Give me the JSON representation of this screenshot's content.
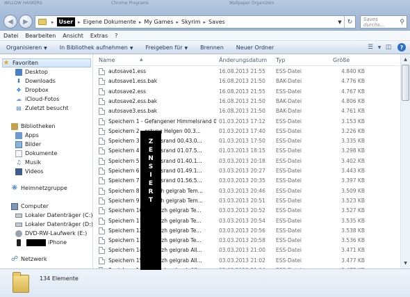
{
  "window": {
    "ghost_title_fragments": [
      "WILLOW HASKERS",
      "Chrome Programs",
      "Wallpaper Organizers"
    ]
  },
  "address": {
    "crumbs": [
      "User",
      "Eigene Dokumente",
      "My Games",
      "Skyrim",
      "Saves"
    ],
    "search_placeholder": "Saves durchs..."
  },
  "menu": [
    "Datei",
    "Bearbeiten",
    "Ansicht",
    "Extras",
    "?"
  ],
  "toolbar": {
    "organize": "Organisieren",
    "include_library": "In Bibliothek aufnehmen",
    "share": "Freigeben für",
    "burn": "Brennen",
    "new_folder": "Neuer Ordner",
    "help": "?"
  },
  "nav": {
    "favorites": "Favoriten",
    "desktop": "Desktop",
    "downloads": "Downloads",
    "dropbox": "Dropbox",
    "icloud": "iCloud-Fotos",
    "recent": "Zuletzt besucht",
    "libraries": "Bibliotheken",
    "apps": "Apps",
    "pictures": "Bilder",
    "documents": "Dokumente",
    "music": "Musik",
    "videos": "Videos",
    "homegroup": "Heimnetzgruppe",
    "computer": "Computer",
    "drive_c": "Lokaler Datenträger (C:)",
    "drive_d": "Lokaler Datenträger (D:)",
    "drive_e": "DVD-RW-Laufwerk (E:)",
    "iphone": "iPhone",
    "network": "Netzwerk"
  },
  "columns": {
    "name": "Name",
    "date": "Änderungsdatum",
    "type": "Typ",
    "size": "Größe"
  },
  "files": [
    {
      "name": "autosave1.ess",
      "date": "16.08.2013 21:55",
      "type": "ESS-Datei",
      "size": "4.840 KB"
    },
    {
      "name": "autosave1.ess.bak",
      "date": "16.08.2013 21:50",
      "type": "BAK-Datei",
      "size": "4.776 KB"
    },
    {
      "name": "autosave2.ess",
      "date": "16.08.2013 21:55",
      "type": "ESS-Datei",
      "size": "4.767 KB"
    },
    {
      "name": "autosave2.ess.bak",
      "date": "16.08.2013 21:50",
      "type": "BAK-Datei",
      "size": "4.806 KB"
    },
    {
      "name": "autosave3.ess.bak",
      "date": "16.08.2013 21:50",
      "type": "BAK-Datei",
      "size": "4.761 KB"
    },
    {
      "name": "Speichern 1 - Gefangener  Himmelsrand  0...",
      "date": "01.03.2013 17:12",
      "type": "ESS-Datei",
      "size": "3.153 KB"
    },
    {
      "name": "Speichern 2 -          estung Helgen  00.3...",
      "date": "01.03.2013 17:40",
      "type": "ESS-Datei",
      "size": "3.226 KB"
    },
    {
      "name": "Speichern 3 -          immelsrand  00.43.0...",
      "date": "01.03.2013 17:50",
      "type": "ESS-Datei",
      "size": "3.335 KB"
    },
    {
      "name": "Speichern 4 -          immelsrand  01.07.5...",
      "date": "01.03.2013 18:15",
      "type": "ESS-Datei",
      "size": "3.298 KB"
    },
    {
      "name": "Speichern 5 -          immelsrand  01.40.1...",
      "date": "03.03.2013 20:18",
      "type": "ESS-Datei",
      "size": "3.402 KB"
    },
    {
      "name": "Speichern 6 -          immelsrand  01.49.1...",
      "date": "03.03.2013 20:27",
      "type": "ESS-Datei",
      "size": "3.443 KB"
    },
    {
      "name": "Speichern 7 -          immelsrand  01.56.5...",
      "date": "03.03.2013 20:35",
      "type": "ESS-Datei",
      "size": "3.397 KB"
    },
    {
      "name": "Speichern 8 -          dsturzh gelgrab  Tem...",
      "date": "03.03.2013 20:46",
      "type": "ESS-Datei",
      "size": "3.509 KB"
    },
    {
      "name": "Speichern 9 -          dsturzh gelgrab  Tem...",
      "date": "03.03.2013 20:51",
      "type": "ESS-Datei",
      "size": "3.523 KB"
    },
    {
      "name": "Speichern 10 -         dsturzh gelgrab  Te...",
      "date": "03.03.2013 20:52",
      "type": "ESS-Datei",
      "size": "3.527 KB"
    },
    {
      "name": "Speichern 11 -         dsturzh gelgrab  Te...",
      "date": "03.03.2013 20:54",
      "type": "ESS-Datei",
      "size": "3.535 KB"
    },
    {
      "name": "Speichern 12 -         dsturzh gelgrab  Te...",
      "date": "03.03.2013 20:56",
      "type": "ESS-Datei",
      "size": "3.538 KB"
    },
    {
      "name": "Speichern 13 -         dsturzh gelgrab  Te...",
      "date": "03.03.2013 20:58",
      "type": "ESS-Datei",
      "size": "3.536 KB"
    },
    {
      "name": "Speichern 14 -         dsturzh gelgrab  All...",
      "date": "03.03.2013 21:00",
      "type": "ESS-Datei",
      "size": "3.471 KB"
    },
    {
      "name": "Speichern 15 -         dsturzh gelgrab  All...",
      "date": "03.03.2013 21:02",
      "type": "ESS-Datei",
      "size": "3.477 KB"
    },
    {
      "name": "Speichern 16 -         dsturzh gelgrab  All...",
      "date": "03.03.2013 21:04",
      "type": "ESS-Datei",
      "size": "3.478 KB"
    }
  ],
  "censor_letters": [
    "Z",
    "E",
    "N",
    "S",
    "I",
    "E",
    "R",
    "T"
  ],
  "status": {
    "item_count": "134 Elemente"
  }
}
